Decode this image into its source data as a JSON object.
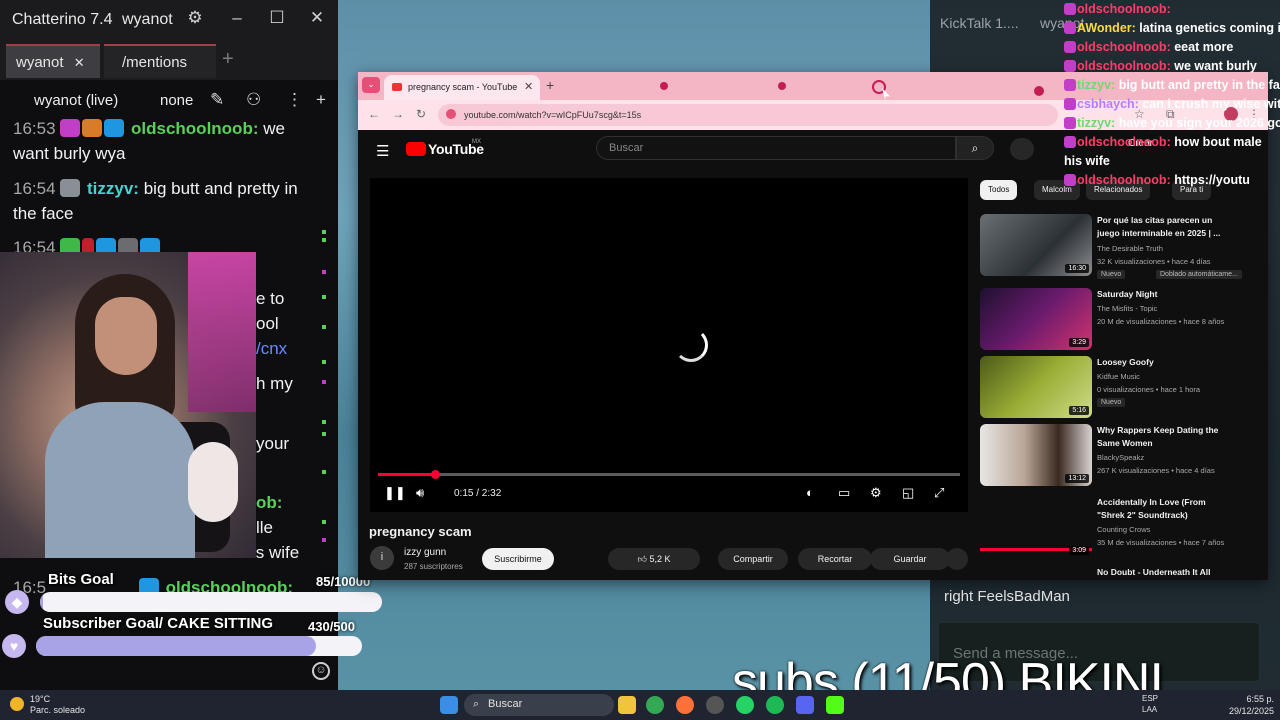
{
  "chatterino": {
    "title": "Chatterino 7.4",
    "user": "wyanot",
    "tabs": [
      {
        "label": "wyanot"
      },
      {
        "label": "/mentions"
      }
    ],
    "add_tab": "+",
    "channel": "wyanot (live)",
    "mode": "none",
    "messages": [
      {
        "time": "16:53",
        "name": "oldschoolnoob:",
        "text": "we want burly wya"
      },
      {
        "time": "16:54",
        "name": "tizzyv:",
        "text": "big butt and pretty in the face"
      },
      {
        "time": "16:54"
      },
      {
        "fragments": [
          "e to",
          "ool",
          "/cnx",
          "h my",
          "your",
          "ob:",
          "lle",
          "is wife"
        ]
      },
      {
        "time": "16:5",
        "name": "oldschoolnoob:"
      }
    ],
    "goals": [
      {
        "label": "Bits Goal",
        "count": "85/10000",
        "fraction": 0.0085
      },
      {
        "label": "Subscriber Goal/ CAKE SITTING",
        "count": "430/500",
        "fraction": 0.86
      }
    ]
  },
  "browser": {
    "tab_title": "pregnancy scam - YouTube",
    "url": "youtube.com/watch?v=wICpFUu7scg&t=15s",
    "colors": {
      "tabbar": "#f4b6c5",
      "toolbar": "#fde2ea"
    }
  },
  "youtube": {
    "logo": "YouTube",
    "region": "MX",
    "search_placeholder": "Buscar",
    "create": "Crear",
    "time": "0:15 / 2:32",
    "progress_fraction": 0.098,
    "video_title": "pregnancy scam",
    "channel": "izzy gunn",
    "avatar_letter": "i",
    "subscribers": "287 suscriptores",
    "subscribe": "Suscribirme",
    "likes": "5,2 K",
    "share": "Compartir",
    "clip": "Recortar",
    "save": "Guardar",
    "chips": [
      "Todos",
      "Malcolm",
      "Relacionados",
      "Para ti"
    ],
    "recommendations": [
      {
        "title": "Por qué las citas parecen un juego interminable en 2025 | ...",
        "channel": "The Desirable Truth",
        "meta": "32 K visualizaciones • hace 4 días",
        "badge": "Nuevo",
        "badge2": "Doblado automáticame...",
        "duration": "16:30"
      },
      {
        "title": "Saturday Night",
        "channel": "The Misfits - Topic",
        "meta": "20 M de visualizaciones • hace 8 años",
        "duration": "3:29"
      },
      {
        "title": "Loosey Goofy",
        "channel": "Kidfue Music",
        "meta": "0 visualizaciones • hace 1 hora",
        "badge": "Nuevo",
        "duration": "5:16"
      },
      {
        "title": "Why Rappers Keep Dating the Same Women",
        "channel": "BlackySpeakz",
        "meta": "267 K visualizaciones • hace 4 días",
        "duration": "13:12"
      },
      {
        "title": "Accidentally In Love (From \"Shrek 2\" Soundtrack)",
        "channel": "Counting Crows",
        "meta": "35 M de visualizaciones • hace 7 años",
        "duration": "3:09"
      },
      {
        "title": "No Doubt - Underneath It All"
      }
    ]
  },
  "kicktalk": {
    "title": "KickTalk 1....",
    "user": "wyanot",
    "messages": [
      {
        "name": "oldschoolnoob:",
        "text": ""
      },
      {
        "name": "AWonder:",
        "text": "latina genetics coming in"
      },
      {
        "name": "oldschoolnoob:",
        "text": "eeat more"
      },
      {
        "name": "oldschoolnoob:",
        "text": "we want burly"
      },
      {
        "name": "tizzyv:",
        "text": "big butt and pretty in the face"
      },
      {
        "name": "csbhaych:",
        "text": "can i crush my wise with"
      },
      {
        "name": "tizzyv:",
        "text": "have you sign your 2026 goa"
      },
      {
        "name": "oldschoolnoob:",
        "text": "how bout male"
      },
      {
        "name": "",
        "text": "his wife"
      },
      {
        "name": "oldschoolnoob:",
        "text": "https://youtu"
      }
    ],
    "last_line": "right FeelsBadMan",
    "input_placeholder": "Send a message..."
  },
  "overlay": {
    "subs_text": "subs (11/50) BIKINI"
  },
  "taskbar": {
    "weather_temp": "19°C",
    "weather_desc": "Parc. soleado",
    "search": "Buscar",
    "lang": "ESP\nLAA",
    "time": "6:55 p.",
    "date": "29/12/2025"
  }
}
